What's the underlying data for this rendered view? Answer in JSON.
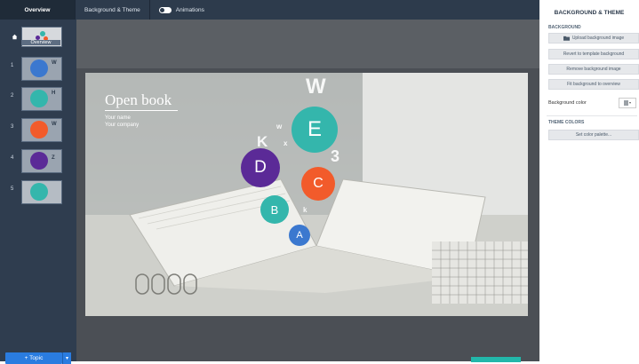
{
  "toolbar": {
    "tab_overview": "Overview",
    "tab_background": "Background & Theme",
    "animations_label": "Animations"
  },
  "sidebar": {
    "overview_label": "Overview",
    "items": [
      {
        "num": "1"
      },
      {
        "num": "2"
      },
      {
        "num": "3"
      },
      {
        "num": "4"
      },
      {
        "num": "5"
      }
    ],
    "topic_button": "+ Topic",
    "topic_drop": "▾"
  },
  "slide": {
    "title": "Open book",
    "line1": "Your name",
    "line2": "Your company",
    "bubbles": {
      "E": "E",
      "D": "D",
      "C": "C",
      "B": "B",
      "A": "A"
    },
    "floaters": {
      "W": "W",
      "K": "K",
      "three": "3",
      "w": "w",
      "x": "x",
      "k": "k"
    }
  },
  "panel": {
    "title": "BACKGROUND & THEME",
    "section_background": "BACKGROUND",
    "upload": "Upload background image",
    "revert": "Revert to template background",
    "remove": "Remove background image",
    "fit": "Fit background to overview",
    "bg_color_label": "Background color",
    "section_theme": "THEME COLORS",
    "palette": "Set color palette..."
  },
  "colors": {
    "teal": "#34b6ac",
    "purple": "#5b2a97",
    "orange": "#f25b2b",
    "blue": "#3b78cf",
    "accent": "#2a7ce0"
  }
}
